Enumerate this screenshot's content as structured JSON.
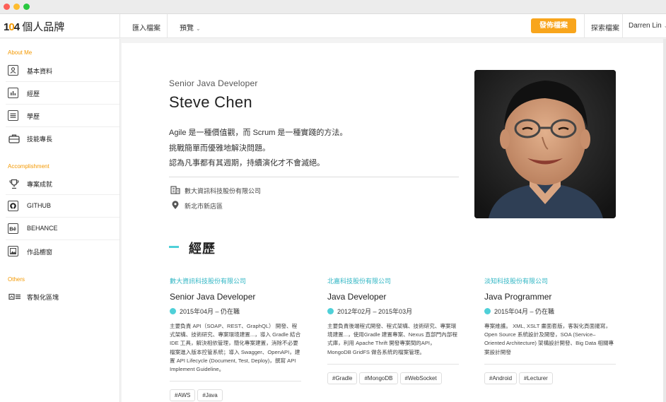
{
  "window": {
    "controls": [
      "close",
      "minimize",
      "maximize"
    ]
  },
  "brand": {
    "number": "104",
    "title": "個人品牌"
  },
  "topnav": {
    "import": "匯入檔案",
    "preview": "預覽",
    "publish": "發佈檔案",
    "explore": "探索檔案",
    "user": "Darren Lin"
  },
  "sidebar": {
    "sections": [
      {
        "title": "About Me",
        "items": [
          {
            "label": "基本資料",
            "icon": "profile-icon"
          },
          {
            "label": "經歷",
            "icon": "bar-chart-icon"
          },
          {
            "label": "學歷",
            "icon": "list-icon"
          },
          {
            "label": "技能專長",
            "icon": "briefcase-icon"
          }
        ]
      },
      {
        "title": "Accomplishment",
        "items": [
          {
            "label": "專案成就",
            "icon": "trophy-icon"
          },
          {
            "label": "GITHUB",
            "icon": "github-icon"
          },
          {
            "label": "BEHANCE",
            "icon": "behance-icon"
          },
          {
            "label": "作品櫥窗",
            "icon": "image-icon"
          }
        ]
      },
      {
        "title": "Others",
        "items": [
          {
            "label": "客製化區塊",
            "icon": "custom-block-icon"
          }
        ]
      }
    ]
  },
  "profile": {
    "job_title": "Senior Java Developer",
    "name": "Steve Chen",
    "bio": [
      "Agile 是一種價值觀，而 Scrum 是一種實踐的方法。",
      "挑戰簡單而優雅地解決問題。",
      "認為凡事都有其週期，持續演化才不會滅絕。"
    ],
    "company": "數大資訊科技股份有限公司",
    "location": "新北市新店區"
  },
  "experience": {
    "heading": "經歷",
    "items": [
      {
        "company": "數大資訊科技股份有限公司",
        "role": "Senior Java Developer",
        "date": "2015年04月 – 仍在職",
        "desc": "主要負責 API（SOAP、REST、GraphQL） 開發、程式架構、技術研究、專案環境建置...，導入 Gradle 結合 IDE 工具，解決相依管理，簡化專案建置，消除不必要檔案進入版本控管系統；導入 Swagger、OpenAPI，建置 API Lifecycle (Document, Test, Deploy)，撰寫 API Implement Guideline。",
        "tags": [
          "#AWS",
          "#Java"
        ]
      },
      {
        "company": "北嘉科技股份有限公司",
        "role": "Java Developer",
        "date": "2012年02月 – 2015年03月",
        "desc": "主要負責後端程式開發、程式架構、技術研究、專案環境建置...，使用Gradle 建置專案、Nexus 直部門內部程式庫，利用 Apache Thrift 開發專案間的API，MongoDB GridFS 做各系統的檔案管理。",
        "tags": [
          "#Gradle",
          "#MongoDB",
          "#WebSocket"
        ]
      },
      {
        "company": "淡知科技股份有限公司",
        "role": "Java Programmer",
        "date": "2015年04月 – 仍在職",
        "desc": "專案維護。 XML, XSLT 畫面套版，客製化頁面擺寫，Open Source 系統設計及開發，SOA (Service–Oriented Architecture) 架構設計開發、Big Data 相關專案設計開發",
        "tags": [
          "#Android",
          "#Lecturer"
        ]
      }
    ]
  }
}
